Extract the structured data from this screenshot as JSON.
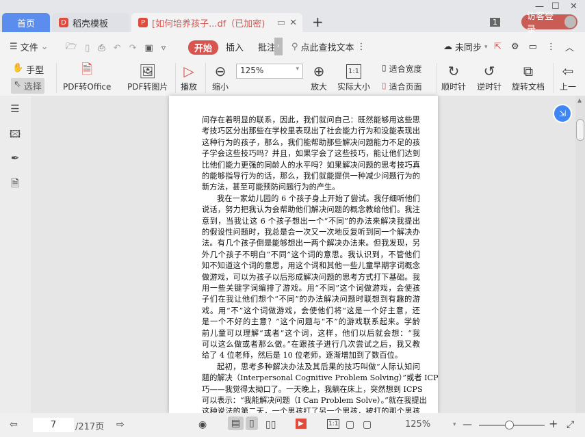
{
  "titlebar": {
    "tabs": [
      {
        "label": "首页"
      },
      {
        "label": "稻壳模板"
      },
      {
        "label": "[如何培养孩子...df（已加密)"
      }
    ],
    "new_tab": "+",
    "badge": "1",
    "login": "访客登录"
  },
  "menu": {
    "file": "文件",
    "start": "开始",
    "insert": "插入",
    "annotate": "批注",
    "search": "点此查找文本",
    "sync": "未同步"
  },
  "toolbar": {
    "hand": "手型",
    "select": "选择",
    "pdf_office": "PDF转Office",
    "pdf_image": "PDF转图片",
    "play": "播放",
    "zoom_out": "缩小",
    "zoom_value": "125%",
    "zoom_in": "放大",
    "actual": "实际大小",
    "actual_icon": "1:1",
    "fit_width": "适合宽度",
    "fit_page": "适合页面",
    "cw": "顺时针",
    "ccw": "逆时针",
    "rotate": "旋转文档",
    "prev": "上一"
  },
  "document": {
    "lines": [
      "间存在着明显的联系，因此，我们就问自己：既然能够用这些思",
      "考技巧区分出那些在学校里表现出了社会能力行为和没能表现出",
      "这种行为的孩子，那么，我们能帮助那些解决问题能力不足的孩",
      "子学会这些技巧吗？并且，如果学会了这些技巧，能让他们达到",
      "比他们能力更强的同龄人的水平吗？如果解决问题的思考技巧真",
      "的能够指导行为的话，那么，我们就能提供一种减少问题行为的",
      "新方法，甚至可能预防问题行为的产生。",
      "我在一家幼儿园的 6 个孩子身上开始了尝试。我仔细听他们",
      "说话，努力把我认为会帮助他们解决问题的概念教给他们。我注",
      "意到，当我让这 6 个孩子想出一个“不同”的办法来解决我提出",
      "的假设性问题时，我总是会一次又一次地反复听到同一个解决办",
      "法。有几个孩子倒是能够想出一两个解决办法来。但我发现，另",
      "外几个孩子不明白“不同”这个词的意思。我认识到，不管他们",
      "知不知道这个词的意思，用这个词和其他一些儿童早期字词概念",
      "做游戏，可以为孩子以后形成解决问题的思考方式打下基础。我",
      "用一些关键字词编排了游戏。用“不同”这个词做游戏，会使孩",
      "子们在我让他们想个“不同”的办法解决问题时联想到有趣的游",
      "戏。用“不”这个词做游戏，会使他们将“这是一个好主意，还",
      "是一个不好的主意？”这个问题与“不”的游戏联系起来。学龄",
      "前儿童可以理解“或者”这个词，这样，他们以后就会想：“我",
      "可以这么做或者那么做。”在跟孩子进行几次尝试之后，我又教",
      "给了 4 位老师，然后是 10 位老师，逐渐增加到了数百位。",
      "起初，思考多种解决办法及其后果的技巧叫做“人际认知问",
      "题的解决（Interpersonal Cognitive Problem Solving）”或者 ICPS 技",
      "巧——我觉得太拗口了。一天晚上，我躺在床上，突然想到 ICPS",
      "可以表示：“我能解决问题（I Can Problem Solve）。”就在我提出",
      "这种说法的第二天，一个男孩打了另一个男孩，被打的那个男孩"
    ]
  },
  "bottom": {
    "page": "7",
    "total": "/217页",
    "zoom": "125%"
  }
}
